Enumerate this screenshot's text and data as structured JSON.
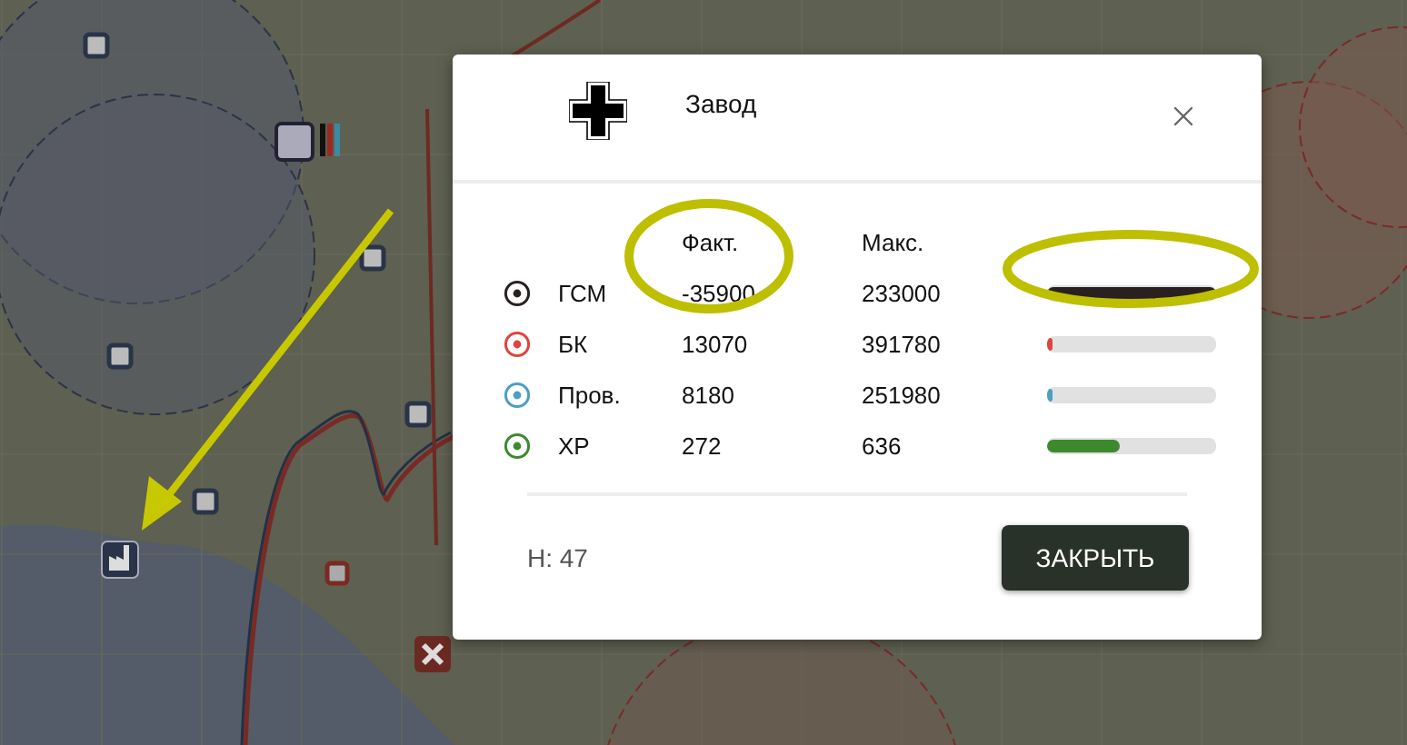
{
  "dialog": {
    "title": "Завод",
    "columns": [
      "Факт.",
      "Макс."
    ],
    "resources": [
      {
        "name": "ГСМ",
        "color": "#2b2020",
        "actual": "-35900",
        "max": "233000",
        "level": 1
      },
      {
        "name": "БК",
        "color": "#e0443c",
        "actual": "13070",
        "max": "391780",
        "level": 0.03
      },
      {
        "name": "Пров.",
        "color": "#4a9fc2",
        "actual": "8180",
        "max": "251980",
        "level": 0.03
      },
      {
        "name": "ХР",
        "color": "#3d8a2e",
        "actual": "272",
        "max": "636",
        "level": 0.43
      }
    ],
    "footer_text": "H: 47",
    "button": "ЗАКРЫТЬ"
  }
}
